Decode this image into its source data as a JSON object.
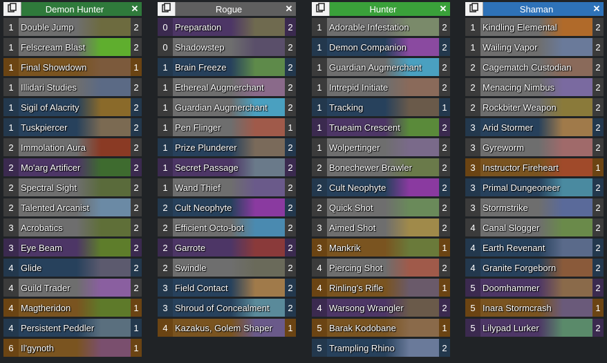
{
  "decks": [
    {
      "title": "Demon Hunter",
      "header_color": "#2f7a3b",
      "cards": [
        {
          "cost": "1",
          "name": "Double Jump",
          "count": "2",
          "rarity": "common",
          "art": "#6d6b3f"
        },
        {
          "cost": "1",
          "name": "Felscream Blast",
          "count": "2",
          "rarity": "common",
          "art": "#5fae2e"
        },
        {
          "cost": "1",
          "name": "Final Showdown",
          "count": "1",
          "rarity": "legendary",
          "art": "#7c5a3c"
        },
        {
          "cost": "1",
          "name": "Illidari Studies",
          "count": "2",
          "rarity": "common",
          "art": "#5b6a85"
        },
        {
          "cost": "1",
          "name": "Sigil of Alacrity",
          "count": "2",
          "rarity": "rare",
          "art": "#8a6a2a"
        },
        {
          "cost": "1",
          "name": "Tuskpiercer",
          "count": "2",
          "rarity": "rare",
          "art": "#7b6a52"
        },
        {
          "cost": "2",
          "name": "Immolation Aura",
          "count": "2",
          "rarity": "common",
          "art": "#8a3a24"
        },
        {
          "cost": "2",
          "name": "Mo'arg Artificer",
          "count": "2",
          "rarity": "epic",
          "art": "#3e6b2f"
        },
        {
          "cost": "2",
          "name": "Spectral Sight",
          "count": "2",
          "rarity": "common",
          "art": "#5a6b3b"
        },
        {
          "cost": "2",
          "name": "Talented Arcanist",
          "count": "2",
          "rarity": "common",
          "art": "#6b8aa5"
        },
        {
          "cost": "3",
          "name": "Acrobatics",
          "count": "2",
          "rarity": "common",
          "art": "#5f6f38"
        },
        {
          "cost": "3",
          "name": "Eye Beam",
          "count": "2",
          "rarity": "epic",
          "art": "#5e7d2b"
        },
        {
          "cost": "4",
          "name": "Glide",
          "count": "2",
          "rarity": "rare",
          "art": "#5c5a6e"
        },
        {
          "cost": "4",
          "name": "Guild Trader",
          "count": "2",
          "rarity": "common",
          "art": "#8a5fa0"
        },
        {
          "cost": "4",
          "name": "Magtheridon",
          "count": "1",
          "rarity": "legendary",
          "art": "#5e7a2a"
        },
        {
          "cost": "4",
          "name": "Persistent Peddler",
          "count": "1",
          "rarity": "rare",
          "art": "#5a6f7e"
        },
        {
          "cost": "6",
          "name": "Il'gynoth",
          "count": "1",
          "rarity": "legendary",
          "art": "#7a4f6e"
        }
      ]
    },
    {
      "title": "Rogue",
      "header_color": "#5f5f5f",
      "cards": [
        {
          "cost": "0",
          "name": "Preparation",
          "count": "2",
          "rarity": "epic",
          "art": "#6f6a4f"
        },
        {
          "cost": "0",
          "name": "Shadowstep",
          "count": "2",
          "rarity": "common",
          "art": "#5a4f6a"
        },
        {
          "cost": "1",
          "name": "Brain Freeze",
          "count": "2",
          "rarity": "rare",
          "art": "#5e8a4a"
        },
        {
          "cost": "1",
          "name": "Ethereal Augmerchant",
          "count": "2",
          "rarity": "common",
          "art": "#8a6a8a"
        },
        {
          "cost": "1",
          "name": "Guardian Augmerchant",
          "count": "2",
          "rarity": "common",
          "art": "#4aa0c0"
        },
        {
          "cost": "1",
          "name": "Pen Flinger",
          "count": "1",
          "rarity": "common",
          "art": "#a05a4a"
        },
        {
          "cost": "1",
          "name": "Prize Plunderer",
          "count": "2",
          "rarity": "rare",
          "art": "#7a6a5a"
        },
        {
          "cost": "1",
          "name": "Secret Passage",
          "count": "2",
          "rarity": "epic",
          "art": "#6a7a8a"
        },
        {
          "cost": "1",
          "name": "Wand Thief",
          "count": "2",
          "rarity": "common",
          "art": "#6a5a8a"
        },
        {
          "cost": "2",
          "name": "Cult Neophyte",
          "count": "2",
          "rarity": "rare",
          "art": "#8a3aa0"
        },
        {
          "cost": "2",
          "name": "Efficient Octo-bot",
          "count": "2",
          "rarity": "common",
          "art": "#4a8ab0"
        },
        {
          "cost": "2",
          "name": "Garrote",
          "count": "2",
          "rarity": "epic",
          "art": "#8a3a3a"
        },
        {
          "cost": "2",
          "name": "Swindle",
          "count": "2",
          "rarity": "common",
          "art": "#6a6a5a"
        },
        {
          "cost": "3",
          "name": "Field Contact",
          "count": "2",
          "rarity": "rare",
          "art": "#a07a4a"
        },
        {
          "cost": "3",
          "name": "Shroud of Concealment",
          "count": "2",
          "rarity": "rare",
          "art": "#5a8a9a"
        },
        {
          "cost": "4",
          "name": "Kazakus, Golem Shaper",
          "count": "1",
          "rarity": "legendary",
          "art": "#6a5a8a"
        }
      ]
    },
    {
      "title": "Hunter",
      "header_color": "#3aa13a",
      "cards": [
        {
          "cost": "1",
          "name": "Adorable Infestation",
          "count": "2",
          "rarity": "common",
          "art": "#7a8a6a"
        },
        {
          "cost": "1",
          "name": "Demon Companion",
          "count": "2",
          "rarity": "rare",
          "art": "#8a4aa0"
        },
        {
          "cost": "1",
          "name": "Guardian Augmerchant",
          "count": "2",
          "rarity": "common",
          "art": "#4aa0c0"
        },
        {
          "cost": "1",
          "name": "Intrepid Initiate",
          "count": "2",
          "rarity": "common",
          "art": "#8a6a5a"
        },
        {
          "cost": "1",
          "name": "Tracking",
          "count": "1",
          "rarity": "rare",
          "art": "#6a5a4a"
        },
        {
          "cost": "1",
          "name": "Trueaim Crescent",
          "count": "2",
          "rarity": "epic",
          "art": "#5a8a3a"
        },
        {
          "cost": "1",
          "name": "Wolpertinger",
          "count": "2",
          "rarity": "common",
          "art": "#7a6a8a"
        },
        {
          "cost": "2",
          "name": "Bonechewer Brawler",
          "count": "2",
          "rarity": "common",
          "art": "#6a7a4a"
        },
        {
          "cost": "2",
          "name": "Cult Neophyte",
          "count": "2",
          "rarity": "rare",
          "art": "#8a3aa0"
        },
        {
          "cost": "2",
          "name": "Quick Shot",
          "count": "2",
          "rarity": "common",
          "art": "#6a8a5a"
        },
        {
          "cost": "3",
          "name": "Aimed Shot",
          "count": "2",
          "rarity": "common",
          "art": "#a08a4a"
        },
        {
          "cost": "3",
          "name": "Mankrik",
          "count": "1",
          "rarity": "legendary",
          "art": "#6a7a3a"
        },
        {
          "cost": "4",
          "name": "Piercing Shot",
          "count": "2",
          "rarity": "common",
          "art": "#a05a4a"
        },
        {
          "cost": "4",
          "name": "Rinling's Rifle",
          "count": "1",
          "rarity": "legendary",
          "art": "#6a5a6a"
        },
        {
          "cost": "4",
          "name": "Warsong Wrangler",
          "count": "2",
          "rarity": "epic",
          "art": "#6a5a4a"
        },
        {
          "cost": "5",
          "name": "Barak Kodobane",
          "count": "1",
          "rarity": "legendary",
          "art": "#8a6a4a"
        },
        {
          "cost": "5",
          "name": "Trampling Rhino",
          "count": "2",
          "rarity": "rare",
          "art": "#6a7a9a"
        }
      ]
    },
    {
      "title": "Shaman",
      "header_color": "#2e72b8",
      "cards": [
        {
          "cost": "1",
          "name": "Kindling Elemental",
          "count": "2",
          "rarity": "common",
          "art": "#b06a2a"
        },
        {
          "cost": "1",
          "name": "Wailing Vapor",
          "count": "2",
          "rarity": "common",
          "art": "#6a7a9a"
        },
        {
          "cost": "2",
          "name": "Cagematch Custodian",
          "count": "2",
          "rarity": "common",
          "art": "#8a6a5a"
        },
        {
          "cost": "2",
          "name": "Menacing Nimbus",
          "count": "2",
          "rarity": "common",
          "art": "#7a6aa0"
        },
        {
          "cost": "2",
          "name": "Rockbiter Weapon",
          "count": "2",
          "rarity": "common",
          "art": "#8a7a3a"
        },
        {
          "cost": "3",
          "name": "Arid Stormer",
          "count": "2",
          "rarity": "rare",
          "art": "#a07a4a"
        },
        {
          "cost": "3",
          "name": "Gyreworm",
          "count": "2",
          "rarity": "common",
          "art": "#a06a6a"
        },
        {
          "cost": "3",
          "name": "Instructor Fireheart",
          "count": "1",
          "rarity": "legendary",
          "art": "#a04a2a"
        },
        {
          "cost": "3",
          "name": "Primal Dungeoneer",
          "count": "2",
          "rarity": "rare",
          "art": "#4a8aa0"
        },
        {
          "cost": "3",
          "name": "Stormstrike",
          "count": "2",
          "rarity": "common",
          "art": "#5a6a9a"
        },
        {
          "cost": "4",
          "name": "Canal Slogger",
          "count": "2",
          "rarity": "common",
          "art": "#6a8a4a"
        },
        {
          "cost": "4",
          "name": "Earth Revenant",
          "count": "2",
          "rarity": "rare",
          "art": "#5a6a8a"
        },
        {
          "cost": "4",
          "name": "Granite Forgeborn",
          "count": "2",
          "rarity": "rare",
          "art": "#8a5a3a"
        },
        {
          "cost": "5",
          "name": "Doomhammer",
          "count": "2",
          "rarity": "epic",
          "art": "#8a6a4a"
        },
        {
          "cost": "5",
          "name": "Inara Stormcrash",
          "count": "1",
          "rarity": "legendary",
          "art": "#6a5a7a"
        },
        {
          "cost": "5",
          "name": "Lilypad Lurker",
          "count": "2",
          "rarity": "epic",
          "art": "#5a8a6a"
        }
      ]
    }
  ]
}
